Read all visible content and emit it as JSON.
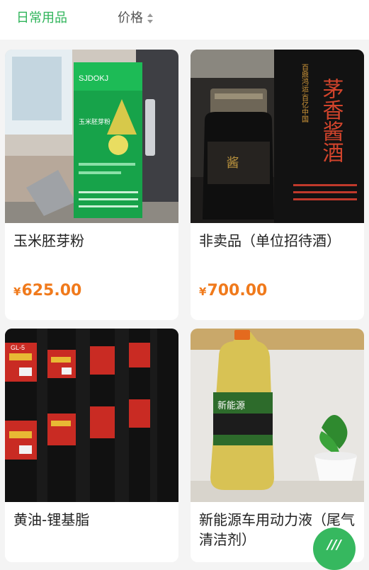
{
  "filters": {
    "category_tab": "日常用品",
    "price_tab": "价格"
  },
  "products": [
    {
      "title": "玉米胚芽粉",
      "currency": "¥",
      "price": "625.00"
    },
    {
      "title": "非卖品（单位招待酒）",
      "currency": "¥",
      "price": "700.00"
    },
    {
      "title": "黄油-锂基脂",
      "currency": "¥",
      "price": ""
    },
    {
      "title": "新能源车用动力液（尾气清洁剂）",
      "currency": "¥",
      "price": ""
    }
  ],
  "image_text": {
    "p1_brand": "SJDOKJ",
    "p1_name": "玉米胚芽粉",
    "p2_name": "茅香酱酒",
    "p2_side": "百鼎鸿运·百亿中国",
    "p3_label": "GL-5",
    "p4_label": "新能源"
  },
  "fab": {
    "label": "///"
  },
  "colors": {
    "accent_green": "#2fb45a",
    "price_orange": "#f07a1c",
    "background": "#f4f4f4"
  }
}
